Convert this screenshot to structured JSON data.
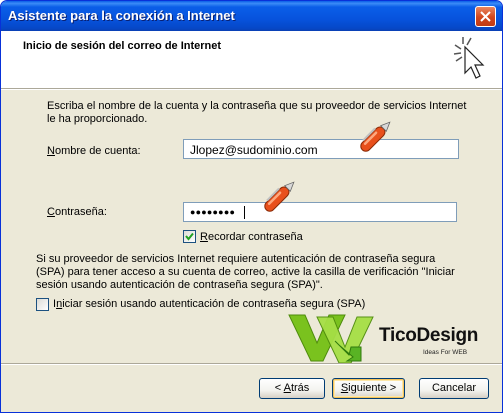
{
  "window": {
    "title": "Asistente para la conexión a Internet"
  },
  "header": {
    "title": "Inicio de sesión del correo de Internet"
  },
  "intro": {
    "line1": "Escriba el nombre de la cuenta y la contraseña que su proveedor de servicios Internet",
    "line2": "le ha proporcionado."
  },
  "account": {
    "label_pre": "",
    "label_u": "N",
    "label_post": "ombre de cuenta:",
    "value": "Jlopez@sudominio.com"
  },
  "password": {
    "label_pre": "",
    "label_u": "C",
    "label_post": "ontraseña:",
    "value": "●●●●●●●●"
  },
  "remember": {
    "label_u": "R",
    "label_post": "ecordar contraseña",
    "checked": true
  },
  "spa": {
    "line1": "Si su proveedor de servicios Internet requiere autenticación de contraseña segura",
    "line2": "(SPA) para tener acceso a su cuenta de correo, active la casilla de verificación \"Iniciar",
    "line3": "sesión usando autenticación de contraseña segura (SPA)\".",
    "checkbox_pre": "I",
    "checkbox_u": "n",
    "checkbox_post": "iciar sesión usando autenticación de contraseña segura (SPA)",
    "checked": false
  },
  "logo": {
    "name": "TicoDesign",
    "tagline": "Ideas For WEB"
  },
  "buttons": {
    "back_pre": "< ",
    "back_u": "A",
    "back_post": "trás",
    "next_u": "S",
    "next_post": "iguiente >",
    "cancel": "Cancelar"
  },
  "colors": {
    "titlebar": "#0a5ee8",
    "dialog": "#ece9d8",
    "pen": "#e8501c",
    "logo_green": "#7ac21e"
  }
}
